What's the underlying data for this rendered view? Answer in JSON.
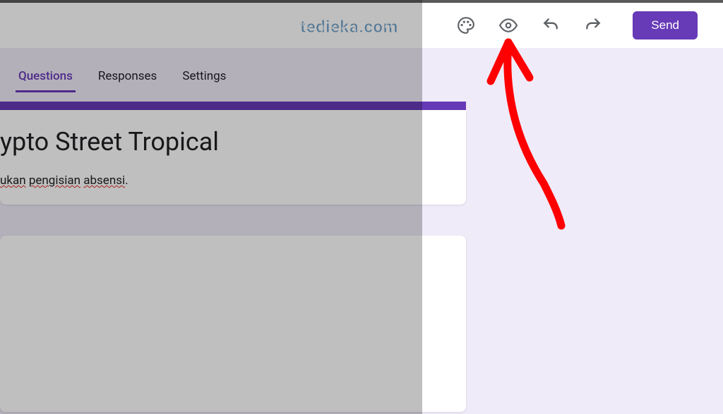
{
  "watermark": "tedieka.com",
  "toolbar": {
    "theme_icon": "palette-icon",
    "preview_icon": "eye-icon",
    "undo_icon": "undo-icon",
    "redo_icon": "redo-icon",
    "send_label": "Send"
  },
  "tabs": {
    "questions": "Questions",
    "responses": "Responses",
    "settings": "Settings",
    "active": "questions"
  },
  "form": {
    "title_fragment": "ypto Street Tropical",
    "description_prefix": "",
    "description_words": [
      "ukan",
      "pengisian",
      "absensi"
    ],
    "description_suffix": "."
  },
  "colors": {
    "accent": "#673ab7",
    "bg": "#f0ebf9",
    "text": "#202124",
    "icon": "#5f6368",
    "annotation": "#ff0000"
  }
}
